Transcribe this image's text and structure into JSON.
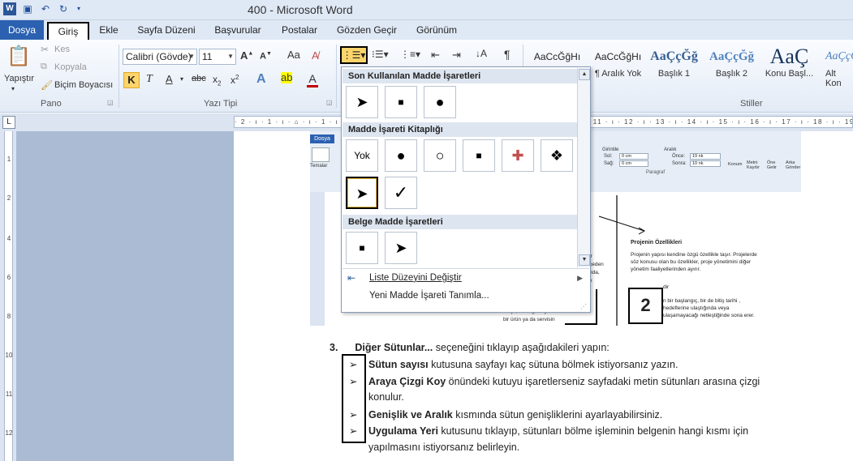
{
  "window": {
    "title": "400  -  Microsoft Word"
  },
  "tabs": [
    "Dosya",
    "Giriş",
    "Ekle",
    "Sayfa Düzeni",
    "Başvurular",
    "Postalar",
    "Gözden Geçir",
    "Görünüm"
  ],
  "ribbon": {
    "clipboard": {
      "paste": "Yapıştır",
      "cut": "Kes",
      "copy": "Kopyala",
      "format_painter": "Biçim Boyacısı",
      "label": "Pano"
    },
    "font": {
      "family": "Calibri (Gövde)",
      "size": "11",
      "label": "Yazı Tipi",
      "bold": "K"
    },
    "styles": {
      "label": "Stiller",
      "items": [
        {
          "preview": "AaCcĞğHı",
          "name": ""
        },
        {
          "preview": "AaCcĞğHı",
          "name": "¶ Aralık Yok"
        },
        {
          "preview": "AaÇçĞğ",
          "name": "Başlık 1"
        },
        {
          "preview": "AaÇçĞğ",
          "name": "Başlık 2"
        },
        {
          "preview": "AaÇ",
          "name": "Konu Başl..."
        },
        {
          "preview": "AaÇçĞ",
          "name": "Alt Kon"
        }
      ]
    }
  },
  "bullet_menu": {
    "recent_header": "Son Kullanılan Madde İşaretleri",
    "library_header": "Madde İşareti Kitaplığı",
    "document_header": "Belge Madde İşaretleri",
    "none_label": "Yok",
    "menu_items": [
      "Liste Düzeyini Değiştir",
      "Yeni Madde İşareti Tanımla..."
    ]
  },
  "embedded": {
    "tab": "Dosya",
    "label_a": "Temalar",
    "labels_b": [
      "Girintile",
      "Aralık",
      "Sol:",
      "Sağ:",
      "Önce:",
      "Sonra:",
      "Paragraf",
      "Konum",
      "Metni Kaydır",
      "Öne Getir",
      "Arka Gönder"
    ],
    "values": [
      "0 cm",
      "0 cm",
      "19 nk",
      "10 nk"
    ],
    "heading": "Projenin Özellikleri",
    "para1": "Projenin yapısı kendine özgü özellikle taşır. Projelerde söz konusu olan bu özellikler, proje yönetimini diğer yönetim faaliyetlerinden ayırır.",
    "para2": "dir",
    "para3": "n bir başlangıç, bir de bitiş tarihi , hedeflerine ulaştığında veya ulaşamayacağı netleştiğinde sona erer.",
    "left_text": [
      "ir",
      "ceden",
      "nda,",
      "e",
      "Proje, bir beğinin yeni",
      "bir ürün ya da servisin"
    ],
    "num_label": "2"
  },
  "document": {
    "step_number": "3.",
    "step_bold": "Diğer Sütunlar...",
    "step_rest": " seçeneğini tıklayıp aşağıdakileri yapın:",
    "bullets": [
      {
        "bold": "Sütun sayısı",
        "rest": " kutusuna sayfayı kaç sütuna bölmek istiyorsanız yazın."
      },
      {
        "bold": "Araya Çizgi Koy",
        "rest": " önündeki kutuyu işaretlerseniz sayfadaki metin sütunları arasına çizgi",
        "cont": "konulur."
      },
      {
        "bold": "Genişlik ve Aralık",
        "rest": " kısmında sütun genişliklerini ayarlayabilirsiniz."
      },
      {
        "bold": "Uygulama Yeri",
        "rest": " kutusunu tıklayıp, sütunları bölme işleminin belgenin hangi kısmı için",
        "cont": "yapılmasını istiyorsanız belirleyin."
      }
    ]
  }
}
